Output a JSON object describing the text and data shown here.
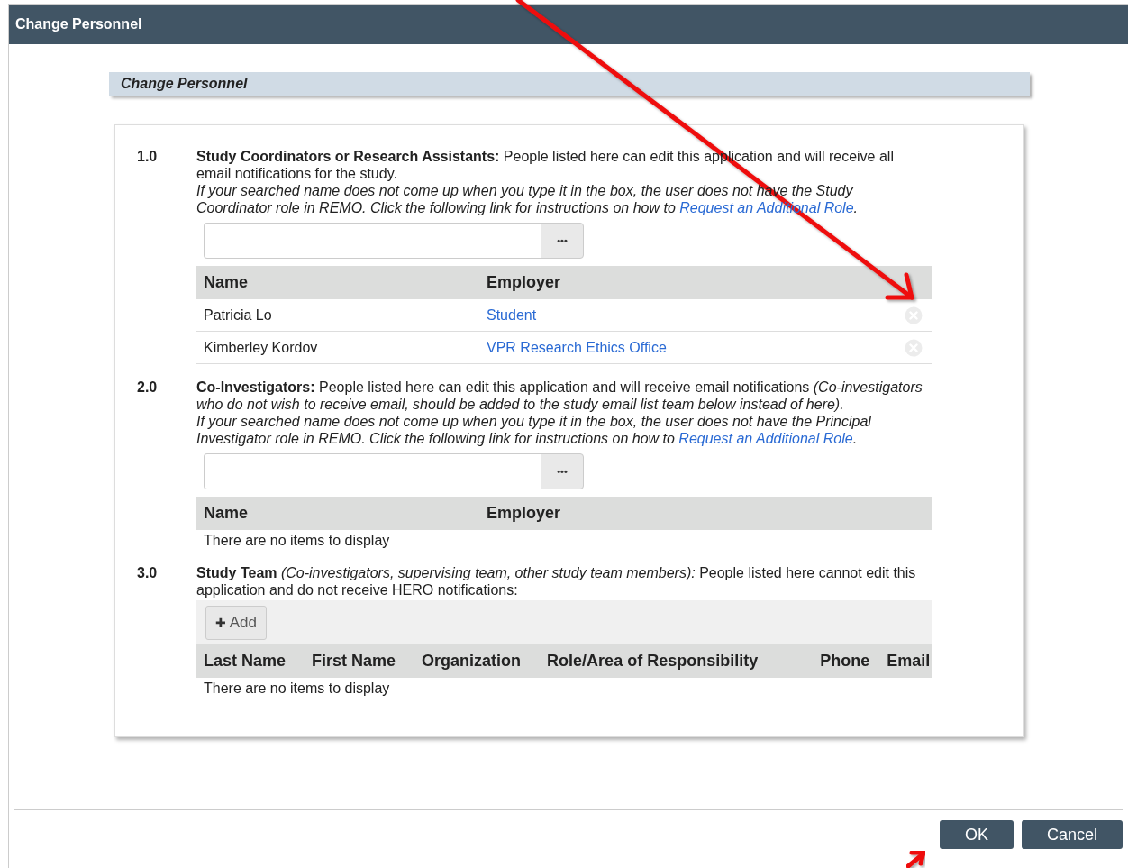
{
  "window": {
    "title": "Change Personnel"
  },
  "panel_title": "Change Personnel",
  "sections": [
    {
      "kind": "people",
      "number": "1.0",
      "text": "**Study Coordinators or Research Assistants:** People listed here can edit this application and will receive all email notifications for the study.",
      "note": "If your searched name does not come up when you type it in the box, the user does not have the Study Coordinator role in REMO. Click the following link for instructions on how to ",
      "link": "Request an Additional Role",
      "note_end": ".",
      "lookup_button": "•••",
      "columns": [
        "Name",
        "Employer"
      ],
      "rows": [
        {
          "name": "Patricia Lo",
          "employer": "Student"
        },
        {
          "name": "Kimberley Kordov",
          "employer": "VPR Research Ethics Office"
        }
      ]
    },
    {
      "kind": "people",
      "number": "2.0",
      "text": "**Co-Investigators:** People listed here can edit this application and will receive email notifications *(Co-investigators who do not wish to receive email, should be added to the study email list team below instead of here).*",
      "note": "If your searched name does not come up when you type it in the box, the user does not have the Principal Investigator role in REMO. Click the following link for instructions on how to ",
      "link": "Request an Additional Role",
      "note_end": ".",
      "lookup_button": "•••",
      "columns": [
        "Name",
        "Employer"
      ],
      "empty_text": "There are no items to display"
    },
    {
      "kind": "team",
      "number": "3.0",
      "text": "**Study Team** *(Co-investigators, supervising team, other study team members):* People listed here cannot edit this application and do not receive HERO notifications:",
      "add_icon": "✚",
      "add_button": "Add",
      "columns": [
        "Last Name",
        "First Name",
        "Organization",
        "Role/Area of Responsibility",
        "Phone",
        "Email"
      ],
      "empty_text": "There are no items to display"
    }
  ],
  "buttons": [
    "OK",
    "Cancel"
  ]
}
